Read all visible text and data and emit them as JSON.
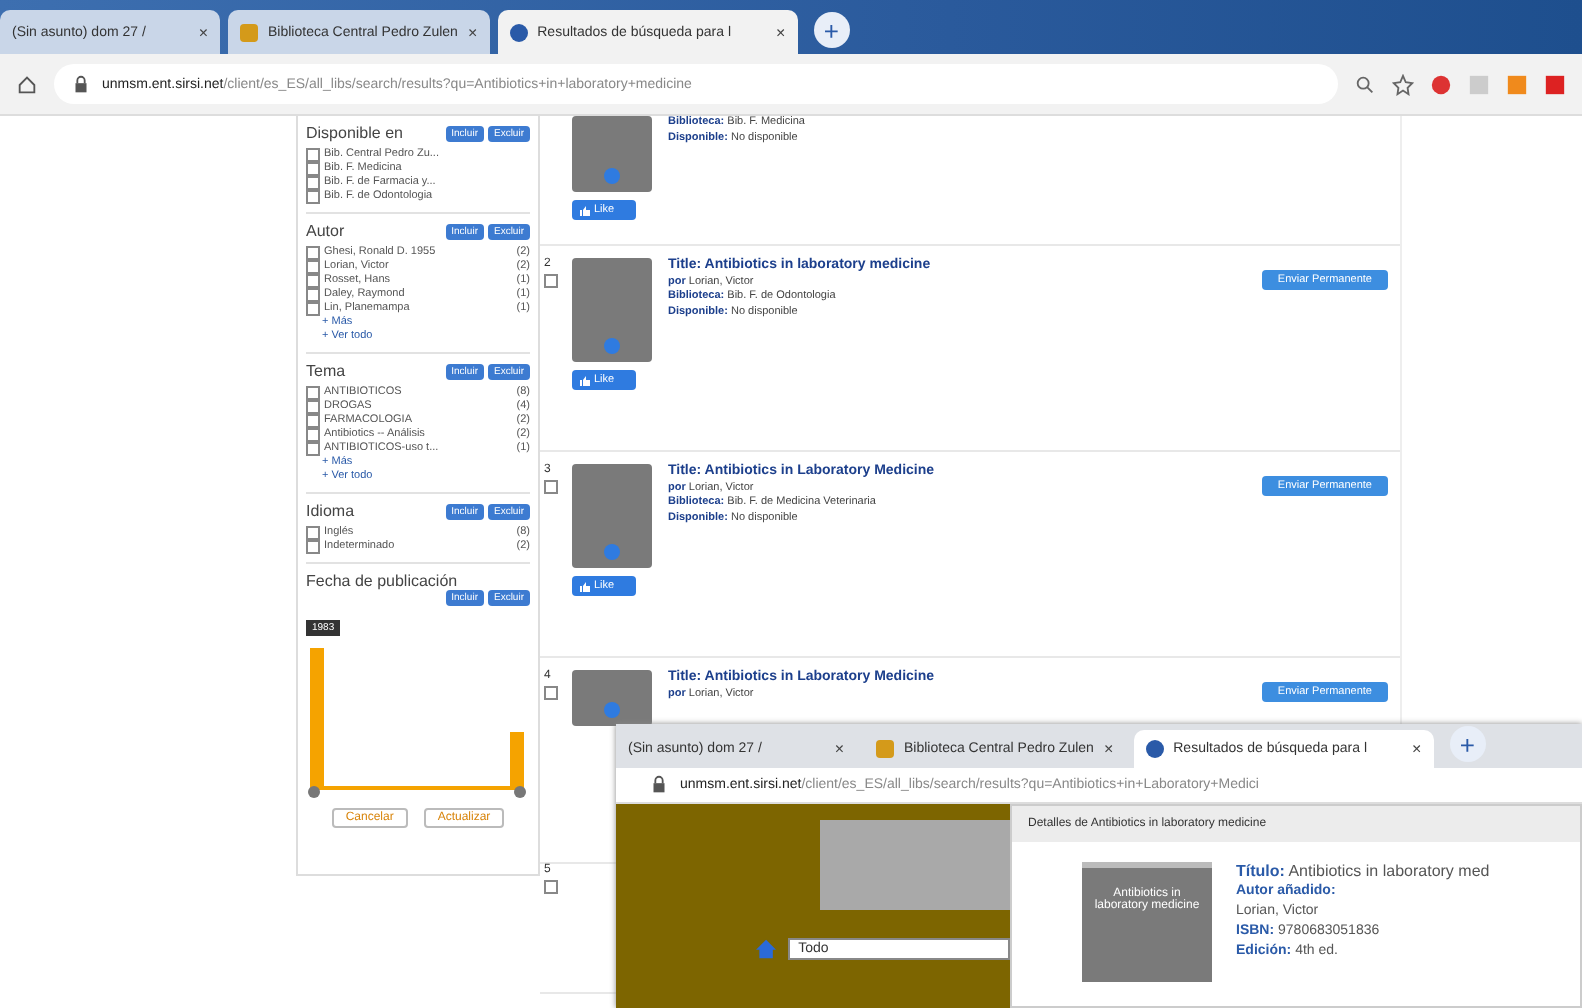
{
  "browser": {
    "tabs": [
      {
        "title": "(Sin asunto) dom 27 /",
        "close": "×",
        "selected": false
      },
      {
        "title": "Biblioteca Central Pedro Zulen",
        "close": "×",
        "selected": false
      },
      {
        "title": "Resultados de búsqueda para l",
        "close": "×",
        "selected": true
      }
    ],
    "new_tab": "+",
    "url_host": "unmsm.ent.sirsi.net",
    "url_path": "/client/es_ES/all_libs/search/results?qu=Antibiotics+in+laboratory+medicine"
  },
  "facets": [
    {
      "title": "Disponible en",
      "actions": [
        "Incluir",
        "Excluir"
      ],
      "options": [
        {
          "label": "Bib. Central Pedro Zu...",
          "checked": false
        },
        {
          "label": "Bib. F. Medicina",
          "checked": false
        },
        {
          "label": "Bib. F. de Farmacia y...",
          "checked": false
        },
        {
          "label": "Bib. F. de Odontologia",
          "checked": false
        }
      ]
    },
    {
      "title": "Autor",
      "actions": [
        "Incluir",
        "Excluir"
      ],
      "options": [
        {
          "label": "Ghesi, Ronald D. 1955",
          "count": "(2)",
          "checked": false
        },
        {
          "label": "Lorian, Victor",
          "count": "(2)",
          "checked": false
        },
        {
          "label": "Rosset, Hans",
          "count": "(1)",
          "checked": false
        },
        {
          "label": "Daley, Raymond",
          "count": "(1)",
          "checked": false
        },
        {
          "label": "Lin, Planemampa",
          "count": "(1)",
          "checked": false
        }
      ],
      "more": [
        "+ Más",
        "+ Ver todo"
      ]
    },
    {
      "title": "Tema",
      "actions": [
        "Incluir",
        "Excluir"
      ],
      "options": [
        {
          "label": "ANTIBIOTICOS",
          "count": "(8)",
          "checked": false
        },
        {
          "label": "DROGAS",
          "count": "(4)",
          "checked": false
        },
        {
          "label": "FARMACOLOGIA",
          "count": "(2)",
          "checked": false
        },
        {
          "label": "Antibiotics -- Análisis",
          "count": "(2)",
          "checked": false
        },
        {
          "label": "ANTIBIOTICOS-uso t...",
          "count": "(1)",
          "checked": false
        }
      ],
      "more": [
        "+ Más",
        "+ Ver todo"
      ]
    },
    {
      "title": "Idioma",
      "actions": [
        "Incluir",
        "Excluir"
      ],
      "options": [
        {
          "label": "Inglés",
          "count": "(8)",
          "checked": false
        },
        {
          "label": "Indeterminado",
          "count": "(2)",
          "checked": false
        }
      ]
    }
  ],
  "date_facet": {
    "title": "Fecha de publicación",
    "actions": [
      "Incluir",
      "Excluir"
    ],
    "year": "1983",
    "buttons": [
      "Cancelar",
      "Actualizar"
    ]
  },
  "results": [
    {
      "fields": [
        {
          "label": "Biblioteca:",
          "value": "Bib. F. Medicina"
        },
        {
          "label": "Disponible:",
          "value": "No disponible"
        }
      ],
      "like": "Like"
    },
    {
      "number": "2",
      "checked": false,
      "title_label": "Title:",
      "title": "Antibiotics in laboratory medicine",
      "fields": [
        {
          "label": "por",
          "value": "Lorian, Victor"
        },
        {
          "label": "Biblioteca:",
          "value": "Bib. F. de Odontologia"
        },
        {
          "label": "Disponible:",
          "value": "No disponible"
        }
      ],
      "action": "Enviar Permanente",
      "like": "Like"
    },
    {
      "number": "3",
      "checked": false,
      "title_label": "Title:",
      "title": "Antibiotics in Laboratory Medicine",
      "fields": [
        {
          "label": "por",
          "value": "Lorian, Victor"
        },
        {
          "label": "Biblioteca:",
          "value": "Bib. F. de Medicina Veterinaria"
        },
        {
          "label": "Disponible:",
          "value": "No disponible"
        }
      ],
      "action": "Enviar Permanente",
      "like": "Like"
    },
    {
      "number": "4",
      "checked": false,
      "title_label": "Title:",
      "title": "Antibiotics in Laboratory Medicine",
      "fields": [
        {
          "label": "por",
          "value": "Lorian, Victor"
        }
      ],
      "action": "Enviar Permanente"
    },
    {
      "number": "5",
      "checked": false
    }
  ],
  "overlay": {
    "tabs": [
      {
        "title": "(Sin asunto) dom 27 /",
        "close": "×",
        "selected": false
      },
      {
        "title": "Biblioteca Central Pedro Zulen",
        "close": "×",
        "selected": false
      },
      {
        "title": "Resultados de búsqueda para l",
        "close": "×",
        "selected": true
      }
    ],
    "new_tab": "+",
    "url_host": "unmsm.ent.sirsi.net",
    "url_path": "/client/es_ES/all_libs/search/results?qu=Antibiotics+in+Laboratory+Medici",
    "search_scope": "Todo",
    "modal_title": "Detalles de Antibiotics in laboratory medicine",
    "cover_text": "Antibiotics in laboratory medicine",
    "fields": [
      {
        "label": "Título:",
        "value": "Antibiotics in laboratory med"
      },
      {
        "label": "Autor añadido:"
      },
      {
        "value": "Lorian, Victor"
      },
      {
        "label": "ISBN:",
        "value": "9780683051836"
      },
      {
        "label": "Edición:",
        "value": "4th ed."
      }
    ]
  }
}
